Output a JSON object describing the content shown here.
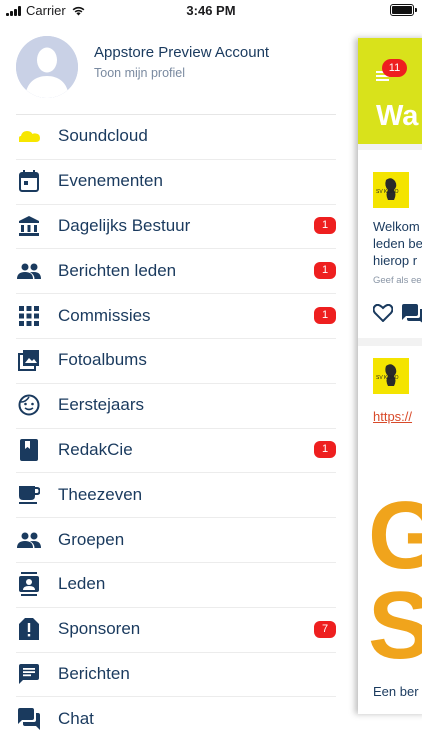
{
  "status_bar": {
    "carrier": "Carrier",
    "time": "3:46 PM"
  },
  "profile": {
    "name": "Appstore Preview Account",
    "link": "Toon mijn profiel"
  },
  "menu": [
    {
      "label": "Soundcloud",
      "icon": "soundcloud-icon",
      "badge": ""
    },
    {
      "label": "Evenementen",
      "icon": "calendar-icon",
      "badge": ""
    },
    {
      "label": "Dagelijks Bestuur",
      "icon": "institution-icon",
      "badge": "1"
    },
    {
      "label": "Berichten leden",
      "icon": "people-icon",
      "badge": "1"
    },
    {
      "label": "Commissies",
      "icon": "grid-icon",
      "badge": "1"
    },
    {
      "label": "Fotoalbums",
      "icon": "photo-album-icon",
      "badge": ""
    },
    {
      "label": "Eerstejaars",
      "icon": "face-icon",
      "badge": ""
    },
    {
      "label": "RedakCie",
      "icon": "book-icon",
      "badge": "1"
    },
    {
      "label": "Theezeven",
      "icon": "cup-icon",
      "badge": ""
    },
    {
      "label": "Groepen",
      "icon": "group-icon",
      "badge": ""
    },
    {
      "label": "Leden",
      "icon": "contacts-icon",
      "badge": ""
    },
    {
      "label": "Sponsoren",
      "icon": "alert-icon",
      "badge": "7"
    },
    {
      "label": "Berichten",
      "icon": "message-icon",
      "badge": ""
    },
    {
      "label": "Chat",
      "icon": "chat-icon",
      "badge": ""
    }
  ],
  "panel": {
    "badge": "11",
    "title": "Wa",
    "card1": {
      "logo_text": "SV KOKO",
      "line1": "Welkom",
      "line2": "leden be",
      "line3": "hierop r",
      "small": "Geef als ee"
    },
    "card2": {
      "logo_text": "SV KOKO",
      "link": "https://",
      "big1": "G",
      "big2": "S",
      "footer": "Een ber"
    }
  },
  "colors": {
    "accent_yellow": "#d9e21b",
    "badge_red": "#ee1f1f",
    "text_navy": "#1a3a5e",
    "soundcloud": "#f7e600"
  }
}
